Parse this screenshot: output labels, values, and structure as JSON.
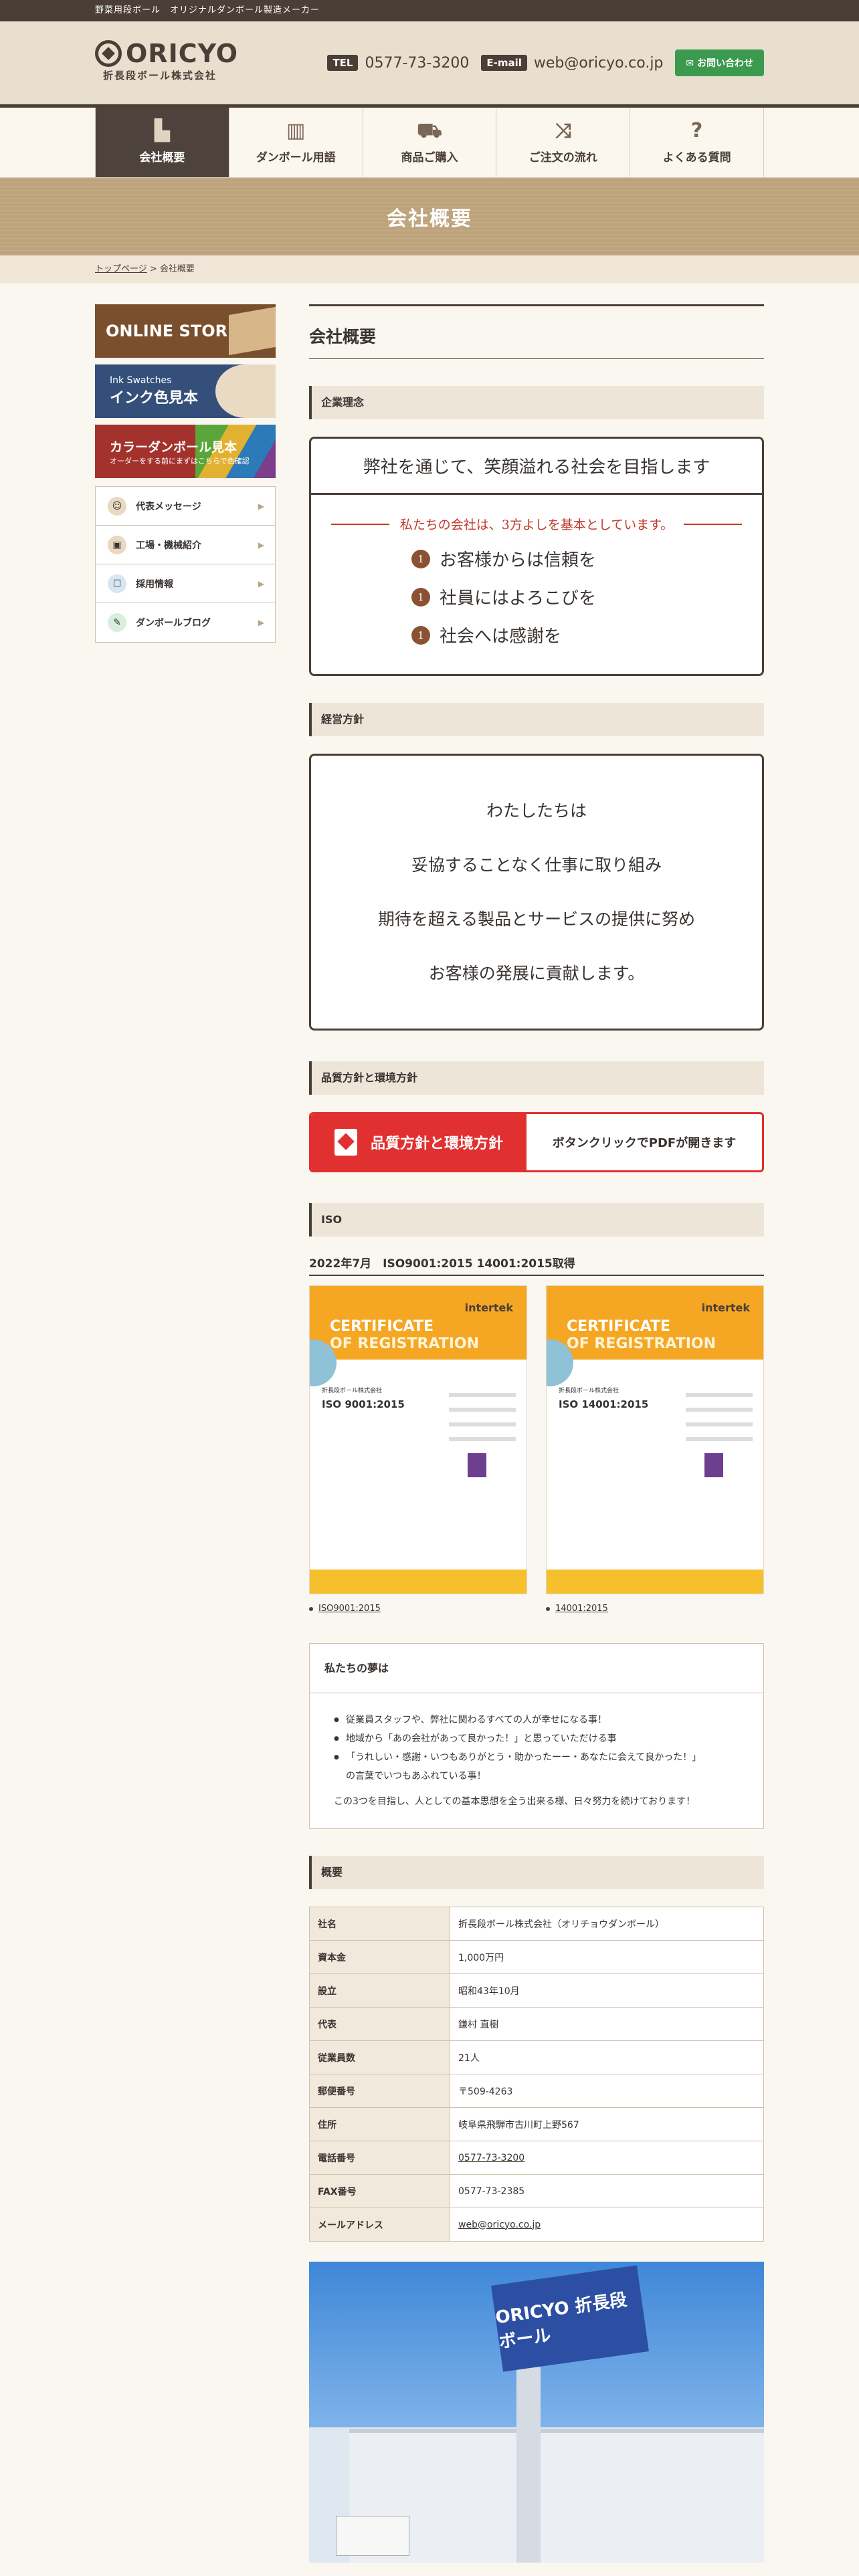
{
  "topbar": {
    "text": "野菜用段ボール　オリジナルダンボール製造メーカー"
  },
  "logo": {
    "name": "ORICYO",
    "sub": "折長段ボール株式会社"
  },
  "contact": {
    "tel_tag": "TEL",
    "tel": "0577-73-3200",
    "mail_tag": "E-mail",
    "mail": "web@oricyo.co.jp",
    "inquiry": "お問い合わせ"
  },
  "nav": [
    {
      "label": "会社概要",
      "icon": "factory-icon"
    },
    {
      "label": "ダンボール用語",
      "icon": "book-icon"
    },
    {
      "label": "商品ご購入",
      "icon": "cart-icon"
    },
    {
      "label": "ご注文の流れ",
      "icon": "shuffle-icon"
    },
    {
      "label": "よくある質問",
      "icon": "question-icon"
    }
  ],
  "hero": {
    "title": "会社概要"
  },
  "breadcrumb": {
    "home": "トップページ",
    "sep": " > ",
    "current": "会社概要"
  },
  "sidebar": {
    "banner1": {
      "line1": "ONLINE STORE"
    },
    "banner2": {
      "small": "Ink Swatches",
      "main": "インク色見本"
    },
    "banner3": {
      "main": "カラーダンボール見本",
      "small": "オーダーをする前にまずはこちらで色確認"
    },
    "menu": [
      {
        "label": "代表メッセージ",
        "color": "#e9d9c2"
      },
      {
        "label": "工場・機械紹介",
        "color": "#e9d9c2"
      },
      {
        "label": "採用情報",
        "color": "#d6e6f3"
      },
      {
        "label": "ダンボールブログ",
        "color": "#d9eedd"
      }
    ]
  },
  "main": {
    "title": "会社概要",
    "rinen": {
      "heading": "企業理念",
      "top": "弊社を通じて、笑顔溢れる社会を目指します",
      "sub": "私たちの会社は、3方よしを基本としています。",
      "items": [
        {
          "num": "1",
          "text": "お客様からは信頼を"
        },
        {
          "num": "1",
          "text": "社員にはよろこびを"
        },
        {
          "num": "1",
          "text": "社会へは感謝を"
        }
      ]
    },
    "policy": {
      "heading": "経営方針",
      "lines": [
        "わたしたちは",
        "妥協することなく仕事に取り組み",
        "期待を超える製品とサービスの提供に努め",
        "お客様の発展に貢献します。"
      ]
    },
    "quality": {
      "heading": "品質方針と環境方針",
      "button_left": "品質方針と環境方針",
      "button_right": "ボタンクリックでPDFが開きます"
    },
    "iso": {
      "heading": "ISO",
      "title": "2022年7月　ISO9001:2015 14001:2015取得",
      "certs": [
        {
          "brand": "intertek",
          "title1": "CERTIFICATE",
          "title2": "OF REGISTRATION",
          "company": "折長段ボール株式会社",
          "std": "ISO 9001:2015",
          "link": "ISO9001:2015"
        },
        {
          "brand": "intertek",
          "title1": "CERTIFICATE",
          "title2": "OF REGISTRATION",
          "company": "折長段ボール株式会社",
          "std": "ISO 14001:2015",
          "link": "14001:2015"
        }
      ]
    },
    "dream": {
      "heading": "私たちの夢は",
      "items": [
        "従業員スタッフや、弊社に関わるすべての人が幸せになる事！",
        "地域から「あの会社があって良かった！」と思っていただける事",
        "「うれしい・感謝・いつもありがとう・助かったーー・あなたに会えて良かった！」",
        "の言葉でいつもあふれている事！"
      ],
      "closing": "この3つを目指し、人としての基本思想を全う出来る様、日々努力を続けております！"
    },
    "overview": {
      "heading": "概要",
      "rows": [
        {
          "k": "社名",
          "v": "折長段ボール株式会社（オリチョウダンボール）"
        },
        {
          "k": "資本金",
          "v": "1,000万円"
        },
        {
          "k": "設立",
          "v": "昭和43年10月"
        },
        {
          "k": "代表",
          "v": "鎌村 直樹"
        },
        {
          "k": "従業員数",
          "v": "21人"
        },
        {
          "k": "郵便番号",
          "v": "〒509-4263"
        },
        {
          "k": "住所",
          "v": "岐阜県飛騨市古川町上野567"
        },
        {
          "k": "電話番号",
          "v": "0577-73-3200"
        },
        {
          "k": "FAX番号",
          "v": "0577-73-2385"
        },
        {
          "k": "メールアドレス",
          "v": "web@oricyo.co.jp"
        }
      ]
    },
    "photo": {
      "sign": "ORICYO 折長段ボール"
    }
  }
}
